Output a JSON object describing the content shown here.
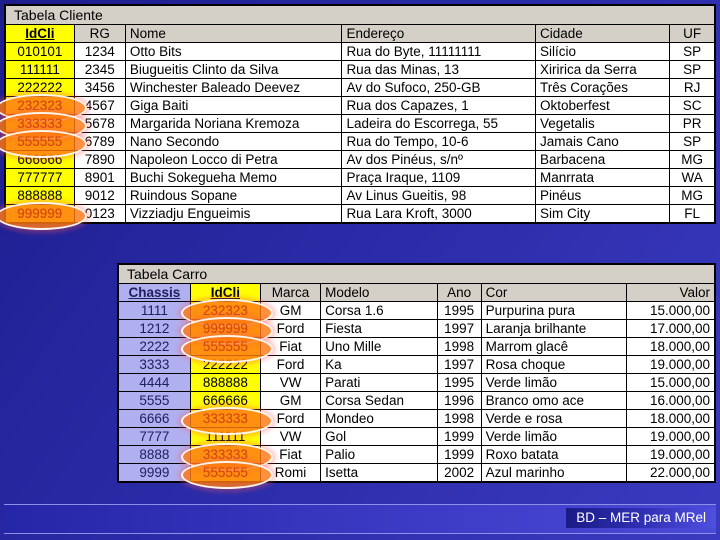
{
  "slide": {
    "background_color": "#2626a0",
    "footer_label": "BD – MER para MRel"
  },
  "cliente_table": {
    "caption": "Tabela Cliente",
    "columns": [
      "IdCli",
      "RG",
      "Nome",
      "Endereço",
      "Cidade",
      "UF"
    ],
    "rows": [
      {
        "idcli": "010101",
        "rg": "1234",
        "nome": "Otto Bits",
        "endereco": "Rua do Byte, 11111111",
        "cidade": "Silício",
        "uf": "SP",
        "highlight": false
      },
      {
        "idcli": "111111",
        "rg": "2345",
        "nome": "Biugueitis Clinto da Silva",
        "endereco": "Rua das Minas, 13",
        "cidade": "Xiririca da Serra",
        "uf": "SP",
        "highlight": false
      },
      {
        "idcli": "222222",
        "rg": "3456",
        "nome": "Winchester Baleado Deevez",
        "endereco": "Av do Sufoco, 250-GB",
        "cidade": "Três Corações",
        "uf": "RJ",
        "highlight": false
      },
      {
        "idcli": "232323",
        "rg": "4567",
        "nome": "Giga Baiti",
        "endereco": "Rua dos Capazes, 1",
        "cidade": "Oktoberfest",
        "uf": "SC",
        "highlight": true
      },
      {
        "idcli": "333333",
        "rg": "5678",
        "nome": "Margarida Noriana Kremoza",
        "endereco": "Ladeira do Escorrega, 55",
        "cidade": "Vegetalis",
        "uf": "PR",
        "highlight": true
      },
      {
        "idcli": "555555",
        "rg": "6789",
        "nome": "Nano Secondo",
        "endereco": "Rua do Tempo, 10-6",
        "cidade": "Jamais Cano",
        "uf": "SP",
        "highlight": true
      },
      {
        "idcli": "666666",
        "rg": "7890",
        "nome": "Napoleon Locco di Petra",
        "endereco": "Av dos Pinéus, s/nº",
        "cidade": "Barbacena",
        "uf": "MG",
        "highlight": false
      },
      {
        "idcli": "777777",
        "rg": "8901",
        "nome": "Buchi Sokegueha Memo",
        "endereco": "Praça Iraque, 1109",
        "cidade": "Manrrata",
        "uf": "WA",
        "highlight": false
      },
      {
        "idcli": "888888",
        "rg": "9012",
        "nome": "Ruindous Sopane",
        "endereco": "Av Linus Gueitis, 98",
        "cidade": "Pinéus",
        "uf": "MG",
        "highlight": false
      },
      {
        "idcli": "999999",
        "rg": "0123",
        "nome": "Vizziadju Engueimis",
        "endereco": "Rua Lara Kroft, 3000",
        "cidade": "Sim City",
        "uf": "FL",
        "highlight": true
      }
    ]
  },
  "carro_table": {
    "caption": "Tabela Carro",
    "columns": [
      "Chassis",
      "IdCli",
      "Marca",
      "Modelo",
      "Ano",
      "Cor",
      "Valor"
    ],
    "rows": [
      {
        "chassis": "1111",
        "idcli": "232323",
        "marca": "GM",
        "modelo": "Corsa 1.6",
        "ano": "1995",
        "cor": "Purpurina pura",
        "valor": "15.000,00",
        "highlight": true
      },
      {
        "chassis": "1212",
        "idcli": "999999",
        "marca": "Ford",
        "modelo": "Fiesta",
        "ano": "1997",
        "cor": "Laranja brilhante",
        "valor": "17.000,00",
        "highlight": true
      },
      {
        "chassis": "2222",
        "idcli": "555555",
        "marca": "Fiat",
        "modelo": "Uno Mille",
        "ano": "1998",
        "cor": "Marrom glacê",
        "valor": "18.000,00",
        "highlight": true
      },
      {
        "chassis": "3333",
        "idcli": "222222",
        "marca": "Ford",
        "modelo": "Ka",
        "ano": "1997",
        "cor": "Rosa choque",
        "valor": "19.000,00",
        "highlight": false
      },
      {
        "chassis": "4444",
        "idcli": "888888",
        "marca": "VW",
        "modelo": "Parati",
        "ano": "1995",
        "cor": "Verde limão",
        "valor": "15.000,00",
        "highlight": false
      },
      {
        "chassis": "5555",
        "idcli": "666666",
        "marca": "GM",
        "modelo": "Corsa Sedan",
        "ano": "1996",
        "cor": "Branco omo ace",
        "valor": "16.000,00",
        "highlight": false
      },
      {
        "chassis": "6666",
        "idcli": "333333",
        "marca": "Ford",
        "modelo": "Mondeo",
        "ano": "1998",
        "cor": "Verde e rosa",
        "valor": "18.000,00",
        "highlight": true
      },
      {
        "chassis": "7777",
        "idcli": "111111",
        "marca": "VW",
        "modelo": "Gol",
        "ano": "1999",
        "cor": "Verde limão",
        "valor": "19.000,00",
        "highlight": false
      },
      {
        "chassis": "8888",
        "idcli": "333333",
        "marca": "Fiat",
        "modelo": "Palio",
        "ano": "1999",
        "cor": "Roxo batata",
        "valor": "19.000,00",
        "highlight": true
      },
      {
        "chassis": "9999",
        "idcli": "555555",
        "marca": "Romi",
        "modelo": "Isetta",
        "ano": "2002",
        "cor": "Azul marinho",
        "valor": "22.000,00",
        "highlight": true
      }
    ]
  },
  "colors": {
    "primary_key": "#ffff00",
    "foreign_key": "#b0b0f0",
    "highlight": "#ff7814",
    "background": "#2626a0"
  }
}
